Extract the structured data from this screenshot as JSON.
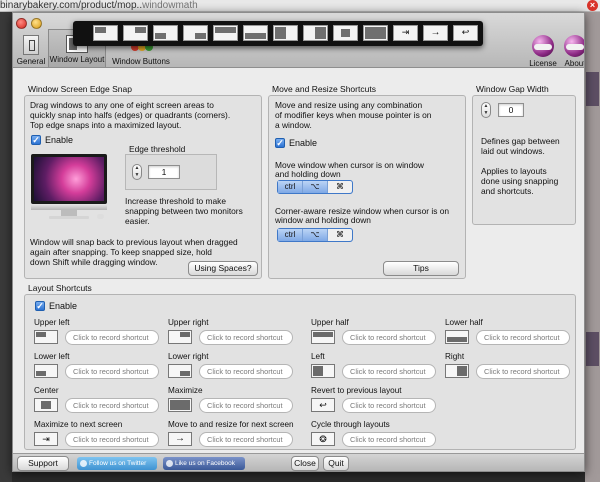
{
  "browser": {
    "url": "binarybakery.com/product/mop..",
    "url_suffix": "windowmath"
  },
  "window": {
    "toolbar": [
      {
        "label": "General",
        "icon": "general-switch-icon"
      },
      {
        "label": "Window Layout",
        "icon": "window-layout-icon"
      },
      {
        "label": "Window Buttons",
        "icon": "window-buttons-icon"
      },
      {
        "label": "License",
        "icon": "license-helmet-icon"
      },
      {
        "label": "About",
        "icon": "about-helmet-icon"
      }
    ]
  },
  "edge_snap": {
    "title": "Window Screen Edge Snap",
    "description_lines": [
      "Drag windows to any one of eight screen areas to",
      "quickly snap into halfs (edges) or quadrants (corners).",
      "Top edge snaps into a maximized layout."
    ],
    "enable_label": "Enable",
    "threshold_label": "Edge threshold",
    "threshold_value": "1",
    "threshold_hint_lines": [
      "Increase threshold to make",
      "snapping between two monitors",
      "easier."
    ],
    "restore_lines": [
      "Window will snap back to previous layout when dragged",
      "again after snapping. To keep snapped size, hold",
      "down Shift while dragging window."
    ],
    "spaces_button": "Using Spaces?"
  },
  "move_resize": {
    "title": "Move and Resize Shortcuts",
    "description_lines": [
      "Move and resize using any combination",
      "of modifier keys when mouse pointer is on",
      "a window."
    ],
    "enable_label": "Enable",
    "move_lines": [
      "Move window when cursor is on window",
      "and holding down"
    ],
    "move_keys": [
      "ctrl",
      "⌥",
      "⌘"
    ],
    "resize_lines": [
      "Corner-aware resize window when cursor is on",
      "window and holding down"
    ],
    "resize_keys": [
      "ctrl",
      "⌥",
      "⌘"
    ],
    "tips_button": "Tips"
  },
  "gap": {
    "title": "Window Gap Width",
    "value": "0",
    "desc1_lines": [
      "Defines gap between",
      "laid out windows."
    ],
    "desc2_lines": [
      "Applies to layouts",
      "done using snapping",
      "and shortcuts."
    ]
  },
  "layout_shortcuts": {
    "title": "Layout Shortcuts",
    "enable_label": "Enable",
    "placeholder": "Click to record shortcut",
    "items": [
      {
        "label": "Upper left",
        "icon": "upper-left-layout-icon"
      },
      {
        "label": "Upper right",
        "icon": "upper-right-layout-icon"
      },
      {
        "label": "Upper half",
        "icon": "upper-half-layout-icon"
      },
      {
        "label": "Lower half",
        "icon": "lower-half-layout-icon"
      },
      {
        "label": "Lower left",
        "icon": "lower-left-layout-icon"
      },
      {
        "label": "Lower right",
        "icon": "lower-right-layout-icon"
      },
      {
        "label": "Left",
        "icon": "left-layout-icon"
      },
      {
        "label": "Right",
        "icon": "right-layout-icon"
      },
      {
        "label": "Center",
        "icon": "center-layout-icon"
      },
      {
        "label": "Maximize",
        "icon": "maximize-layout-icon"
      },
      {
        "label": "Revert to previous layout",
        "icon": "revert-layout-icon"
      },
      {
        "label": "Maximize to next screen",
        "icon": "next-screen-layout-icon"
      },
      {
        "label": "Move to and resize for next screen",
        "icon": "move-next-screen-icon"
      },
      {
        "label": "Cycle through layouts",
        "icon": "cycle-layouts-icon"
      }
    ]
  },
  "footer": {
    "support": "Support",
    "twitter": "Follow us on Twitter",
    "facebook": "Like us on Facebook",
    "close": "Close",
    "quit": "Quit"
  }
}
